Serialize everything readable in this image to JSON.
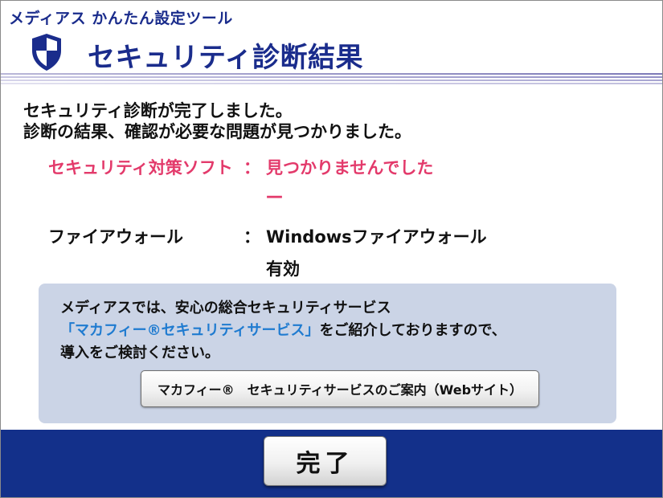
{
  "app": {
    "title": "メディアス かんたん設定ツール"
  },
  "header": {
    "title": "セキュリティ診断結果",
    "icon": "shield-icon",
    "accent_color": "#1a2c8c"
  },
  "summary": {
    "line1": "セキュリティ診断が完了しました。",
    "line2": "診断の結果、確認が必要な問題が見つかりました。"
  },
  "results": {
    "antivirus": {
      "label": "セキュリティ対策ソフト",
      "separator": "：",
      "value": "見つかりませんでした",
      "status": "—",
      "color": "#e33a6b"
    },
    "firewall": {
      "label": "ファイアウォール",
      "separator": "：",
      "value": "Windowsファイアウォール",
      "status": "有効"
    }
  },
  "recommendation": {
    "line1": "メディアスでは、安心の総合セキュリティサービス",
    "line2_link": "「マカフィー®セキュリティサービス」",
    "line2_rest": "をご紹介しておりますので、",
    "line3": "導入をご検討ください。",
    "button_label": "マカフィー®　セキュリティサービスのご案内（Webサイト）",
    "link_color": "#1f7bd0",
    "panel_color": "#cbd4e6"
  },
  "footer": {
    "done_label": "完了",
    "background_color": "#13308a"
  }
}
